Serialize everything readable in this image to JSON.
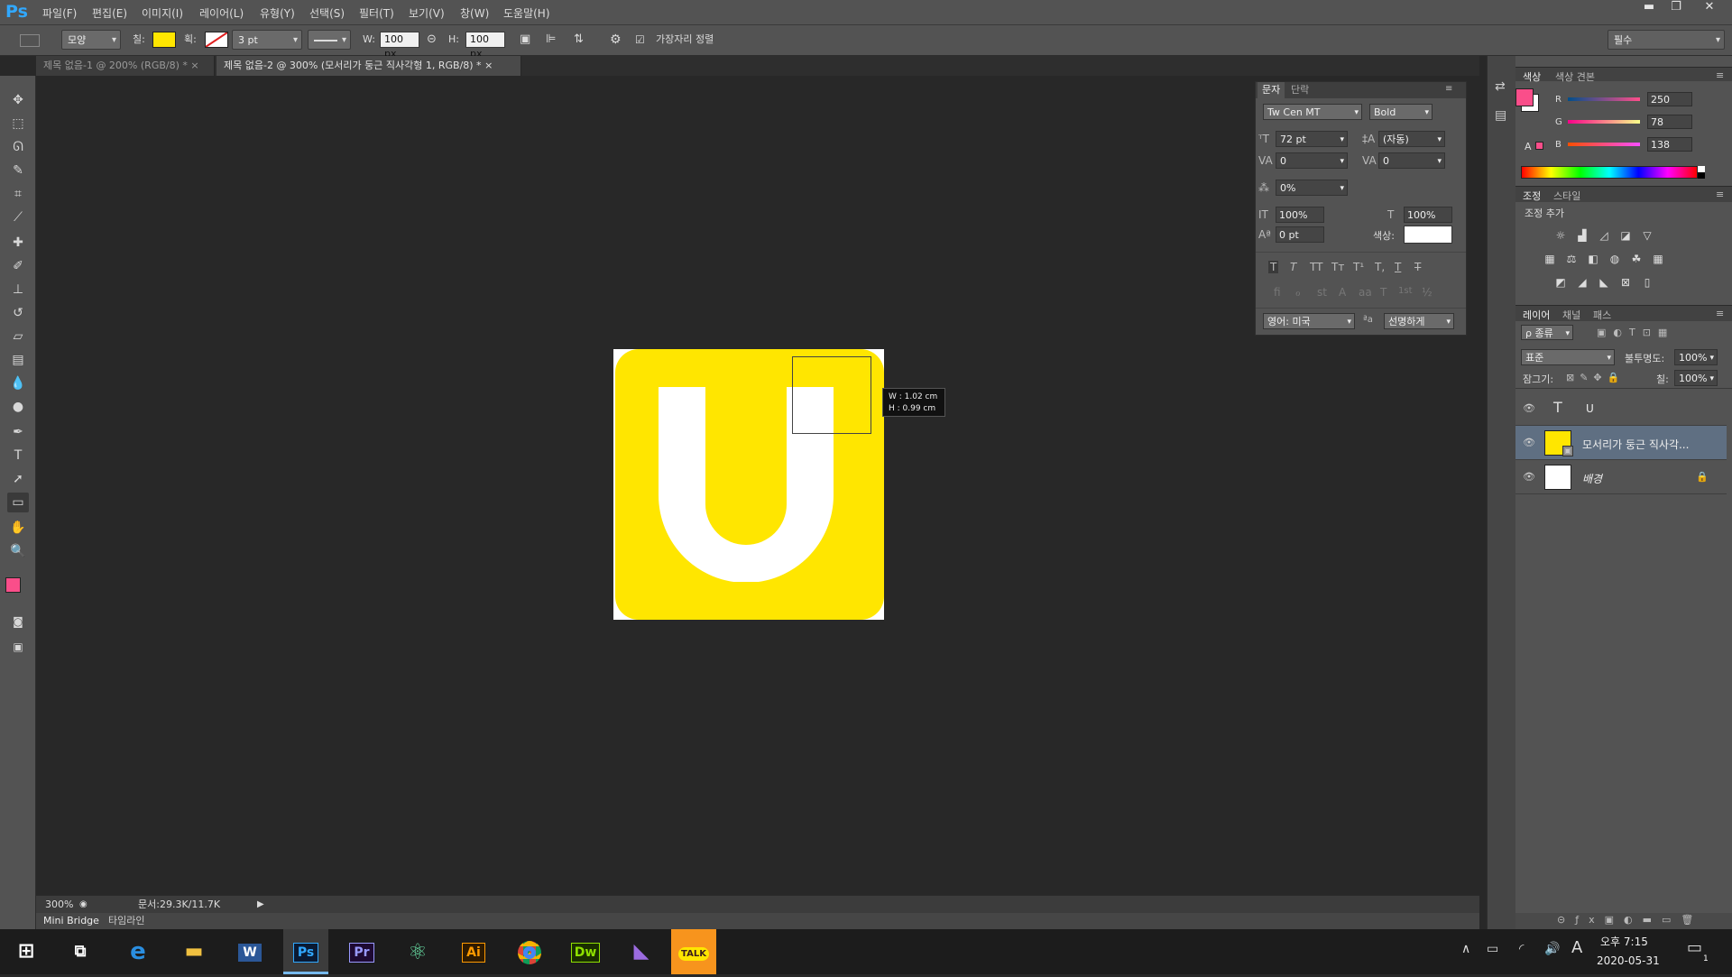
{
  "app": {
    "logo": "Ps"
  },
  "menu": [
    "파일(F)",
    "편집(E)",
    "이미지(I)",
    "레이어(L)",
    "유형(Y)",
    "선택(S)",
    "필터(T)",
    "보기(V)",
    "창(W)",
    "도움말(H)"
  ],
  "window_controls": {
    "minimize": "▬",
    "restore": "❐",
    "close": "✕"
  },
  "options": {
    "mode_value": "모양",
    "fill_label": "칠:",
    "fill_color": "#ffe600",
    "stroke_label": "획:",
    "stroke_size": "3 pt",
    "w_label": "W:",
    "w_value": "100 px",
    "h_label": "H:",
    "h_value": "100 px",
    "align_edges_label": "가장자리 정렬",
    "workspace": "필수"
  },
  "tabs": [
    {
      "label": "제목 없음-1 @ 200% (RGB/8) *"
    },
    {
      "label": "제목 없음-2 @ 300% (모서리가 둥근 직사각형 1, RGB/8) *"
    }
  ],
  "tools": [
    "move-icon",
    "marquee-icon",
    "lasso-icon",
    "quick-select-icon",
    "crop-icon",
    "eyedropper-icon",
    "healing-icon",
    "brush-icon",
    "stamp-icon",
    "history-brush-icon",
    "eraser-icon",
    "gradient-icon",
    "blur-icon",
    "dodge-icon",
    "pen-icon",
    "type-icon",
    "path-select-icon",
    "shape-icon",
    "hand-icon",
    "zoom-icon"
  ],
  "colors": {
    "foreground": "#fa4e8a",
    "background": "#ffffff",
    "yellow": "#ffe600"
  },
  "canvas": {
    "measure_w": "W :  1.02 cm",
    "measure_h": "H :  0.99 cm"
  },
  "status": {
    "zoom": "300%",
    "doc": "문서:29.3K/11.7K"
  },
  "bottom_tabs": {
    "mini_bridge": "Mini Bridge",
    "timeline": "타임라인"
  },
  "char_panel": {
    "tab_char": "문자",
    "tab_para": "단락",
    "font_family": "Tw Cen MT",
    "font_style": "Bold",
    "font_size": "72 pt",
    "leading": "(자동)",
    "kerning": "0",
    "tracking": "0",
    "tsume": "0%",
    "vscale": "100%",
    "hscale": "100%",
    "baseline": "0 pt",
    "color_label": "색상:",
    "language": "영어: 미국",
    "aa_label": "ªa",
    "antialias": "선명하게",
    "type_buttons": [
      "T",
      "T",
      "TT",
      "Tт",
      "T¹",
      "T,",
      "T",
      "T"
    ],
    "opentype_buttons": [
      "ﬁ",
      "ℴ",
      "st",
      "A",
      "aa",
      "T",
      "1st",
      "½"
    ]
  },
  "color_panel": {
    "tab_color": "색상",
    "tab_swatches": "색상 견본",
    "r_label": "R",
    "r_value": "250",
    "g_label": "G",
    "g_value": "78",
    "b_label": "B",
    "b_value": "138"
  },
  "adjust_panel": {
    "tab_adjust": "조정",
    "tab_style": "스타일",
    "add_label": "조정 추가"
  },
  "layers_panel": {
    "tab_layers": "레이어",
    "tab_channels": "채널",
    "tab_paths": "패스",
    "filter_kind": "ρ 종류",
    "blend_mode": "표준",
    "opacity_label": "불투명도:",
    "opacity_value": "100%",
    "lock_label": "잠그기:",
    "fill_label": "칠:",
    "fill_value": "100%",
    "layers": [
      {
        "name": "U",
        "type": "text"
      },
      {
        "name": "모서리가 둥근 직사각...",
        "type": "shape",
        "selected": true
      },
      {
        "name": "배경",
        "type": "background"
      }
    ]
  },
  "taskbar": {
    "apps": [
      "Windows",
      "Task View",
      "Edge",
      "Explorer",
      "Word",
      "Photoshop",
      "Premiere",
      "Atom",
      "Illustrator",
      "Chrome",
      "Dreamweaver",
      "Visual Studio",
      "KakaoTalk"
    ],
    "app_labels": {
      "word": "W",
      "ps": "Ps",
      "pr": "Pr",
      "ai": "Ai",
      "dw": "Dw",
      "talk": "TALK"
    },
    "time": "오후 7:15",
    "date": "2020-05-31",
    "ime": "A",
    "notif_count": "1"
  }
}
